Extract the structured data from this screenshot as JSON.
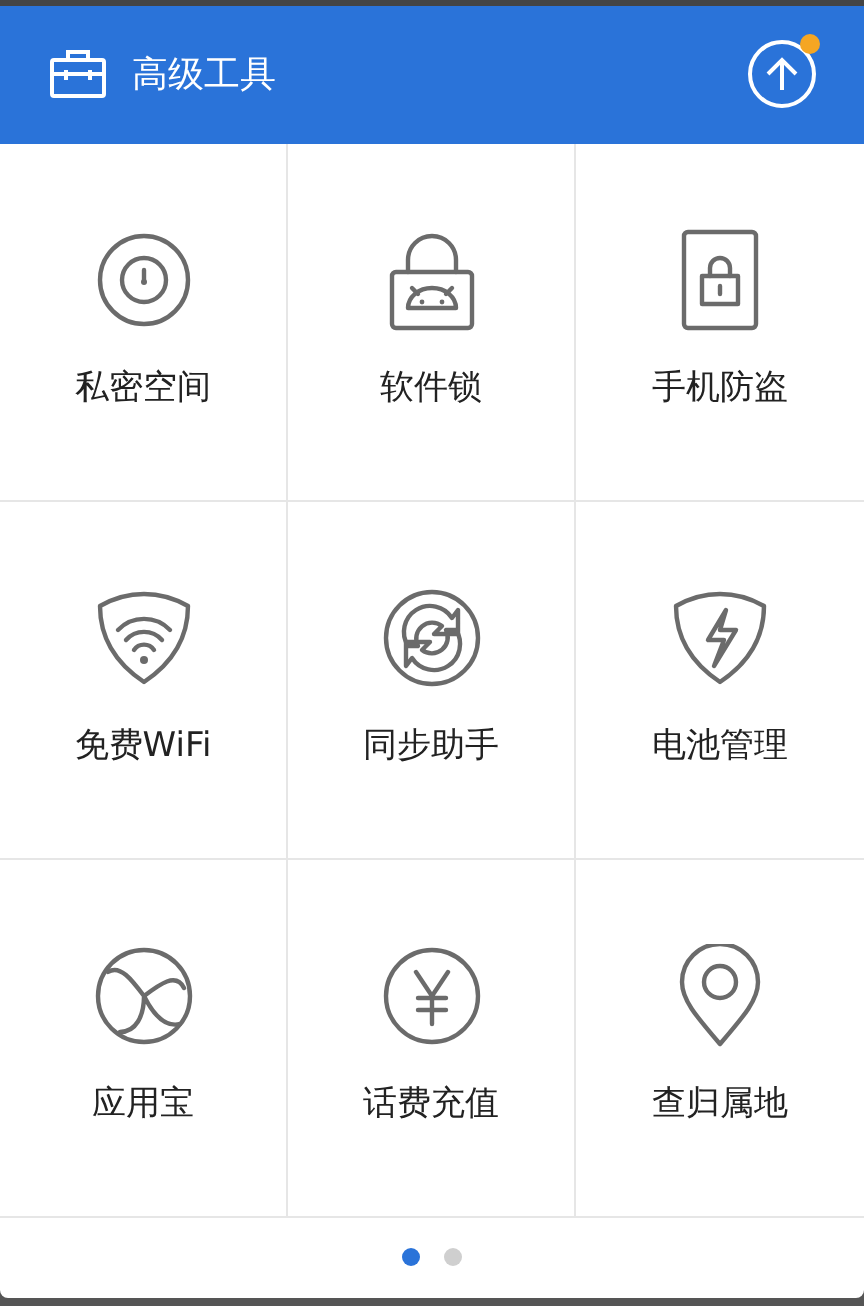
{
  "header": {
    "title": "高级工具",
    "update_badge": true
  },
  "tools": [
    {
      "label": "私密空间",
      "kind": "safe"
    },
    {
      "label": "软件锁",
      "kind": "android-lock"
    },
    {
      "label": "手机防盗",
      "kind": "phone-lock"
    },
    {
      "label": "免费WiFi",
      "kind": "wifi"
    },
    {
      "label": "同步助手",
      "kind": "sync"
    },
    {
      "label": "电池管理",
      "kind": "bolt"
    },
    {
      "label": "应用宝",
      "kind": "fan"
    },
    {
      "label": "话费充值",
      "kind": "yen"
    },
    {
      "label": "查归属地",
      "kind": "pin"
    }
  ],
  "pager": [
    {
      "selected": true
    },
    {
      "selected": false
    }
  ]
}
